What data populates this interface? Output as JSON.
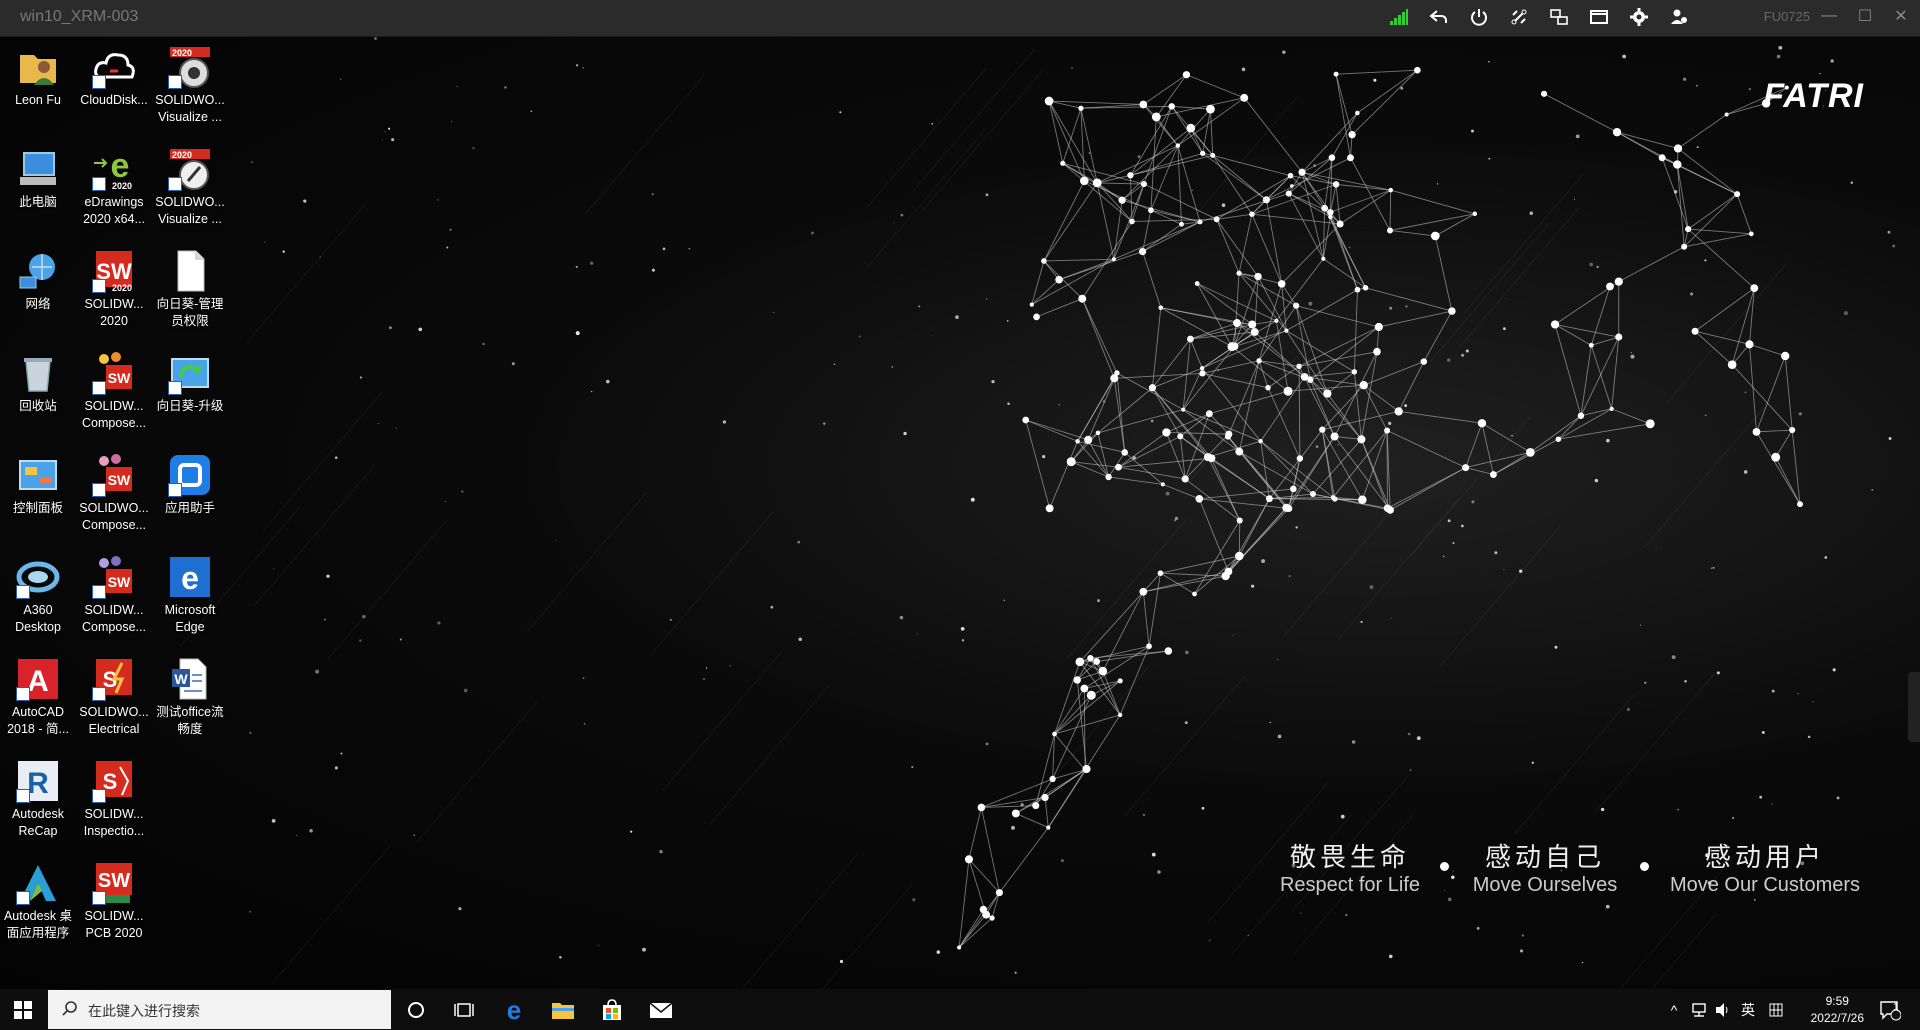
{
  "session": {
    "title": "win10_XRM-003",
    "session_id": "FU0725"
  },
  "wallpaper": {
    "brand": "FATRI",
    "slogans": [
      {
        "cn": "敬畏生命",
        "en": "Respect for Life"
      },
      {
        "cn": "感动自己",
        "en": "Move Ourselves"
      },
      {
        "cn": "感动用户",
        "en": "Move Our Customers"
      }
    ]
  },
  "desktop_icons": [
    {
      "label": "Leon Fu",
      "icon": "user-folder-icon"
    },
    {
      "label": "此电脑",
      "icon": "computer-icon"
    },
    {
      "label": "网络",
      "icon": "network-icon"
    },
    {
      "label": "回收站",
      "icon": "recycle-bin-icon"
    },
    {
      "label": "控制面板",
      "icon": "control-panel-icon"
    },
    {
      "label": "A360 Desktop",
      "icon": "a360-icon"
    },
    {
      "label": "AutoCAD 2018 - 简...",
      "icon": "autocad-icon"
    },
    {
      "label": "Autodesk ReCap",
      "icon": "recap-icon"
    },
    {
      "label": "Autodesk 桌面应用程序",
      "icon": "autodesk-app-icon"
    },
    {
      "label": "CloudDisk...",
      "icon": "cloud-disk-icon"
    },
    {
      "label": "eDrawings 2020 x64...",
      "icon": "edrawings-icon"
    },
    {
      "label": "SOLIDW... 2020",
      "icon": "solidworks-icon"
    },
    {
      "label": "SOLIDW... Compose...",
      "icon": "solidworks-composer-icon"
    },
    {
      "label": "SOLIDWO... Compose...",
      "icon": "solidworks-composer-icon"
    },
    {
      "label": "SOLIDW... Compose...",
      "icon": "solidworks-composer-icon"
    },
    {
      "label": "SOLIDWO... Electrical",
      "icon": "solidworks-electrical-icon"
    },
    {
      "label": "SOLIDW... Inspectio...",
      "icon": "solidworks-inspection-icon"
    },
    {
      "label": "SOLIDW... PCB 2020",
      "icon": "solidworks-pcb-icon"
    },
    {
      "label": "SOLIDWO... Visualize ...",
      "icon": "solidworks-visualize-icon"
    },
    {
      "label": "SOLIDWO... Visualize ...",
      "icon": "solidworks-visualize-icon"
    },
    {
      "label": "向日葵-管理员权限",
      "icon": "file-icon"
    },
    {
      "label": "向日葵-升级",
      "icon": "sunlogin-upgrade-icon"
    },
    {
      "label": "应用助手",
      "icon": "app-helper-icon"
    },
    {
      "label": "Microsoft Edge",
      "icon": "edge-icon"
    },
    {
      "label": "测试office流畅度",
      "icon": "word-doc-icon"
    }
  ],
  "taskbar": {
    "search_placeholder": "在此键入进行搜索",
    "ime": "英",
    "time": "9:59",
    "date": "2022/7/26",
    "notifications": "1"
  }
}
